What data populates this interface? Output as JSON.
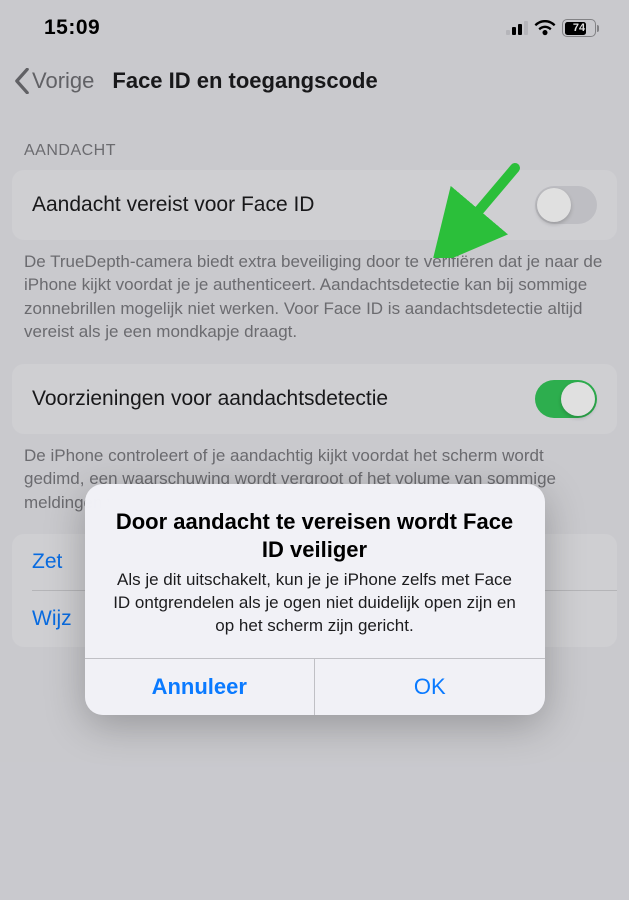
{
  "statusBar": {
    "time": "15:09",
    "battery": "74"
  },
  "nav": {
    "back": "Vorige",
    "title": "Face ID en toegangscode"
  },
  "sections": {
    "attention": {
      "header": "AANDACHT",
      "toggleLabel": "Aandacht vereist voor Face ID",
      "footer": "De TrueDepth-camera biedt extra beveiliging door te verifiëren dat je naar de iPhone kijkt voordat je je authenticeert. Aandachtsdetectie kan bij sommige zonnebrillen mogelijk niet werken. Voor Face ID is aandachtsdetectie altijd vereist als je een mondkapje draagt."
    },
    "second": {
      "label": "Voorzieningen voor aandachtsdetectie",
      "footer": "De iPhone controleert of je aandachtig kijkt voordat het scherm wordt gedimd, een waarschuwing wordt vergroot of het volume van sommige meldingen wordt verlaagd."
    },
    "links": {
      "item1": "Zet",
      "item2": "Wijz"
    }
  },
  "alert": {
    "title": "Door aandacht te vereisen wordt Face ID veiliger",
    "message": "Als je dit uitschakelt, kun je je iPhone zelfs met Face ID ontgrendelen als je ogen niet duidelijk open zijn en op het scherm zijn gericht.",
    "cancel": "Annuleer",
    "ok": "OK"
  }
}
